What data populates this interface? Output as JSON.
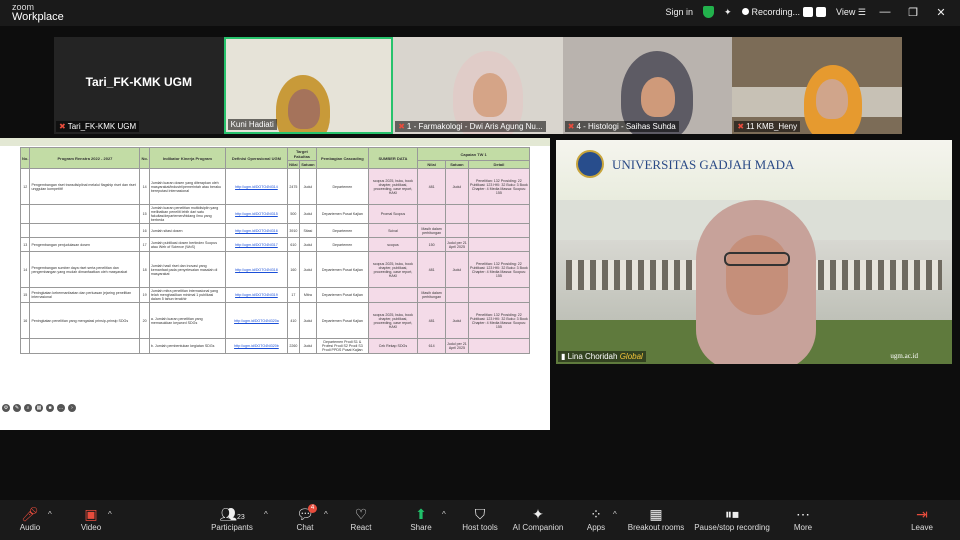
{
  "app": {
    "line1": "zoom",
    "line2": "Workplace"
  },
  "titlebar": {
    "sign_in": "Sign in",
    "recording": "Recording...",
    "view": "View"
  },
  "gallery": [
    {
      "name": "Tari_FK-KMK UGM",
      "big": "Tari_FK-KMK UGM"
    },
    {
      "name": "Kuni Hadiati"
    },
    {
      "name": "1 - Farmakologi - Dwi Aris Agung Nu..."
    },
    {
      "name": "4 - Histologi - Saihas Suhda"
    },
    {
      "name": "11 KMB_Heny"
    }
  ],
  "sheet": {
    "headers": [
      "No.",
      "Program Renstra 2022 - 2027",
      "No.",
      "Indikator Kinerja Program",
      "Definisi Operasional UGM",
      "Target Fakultas",
      "Pembagian Cascading",
      "SUMBER DATA",
      "Capaian TW 1"
    ],
    "subheaders": [
      "Nilai",
      "Satuan",
      "Nilai",
      "Satuan",
      "Detail"
    ],
    "rows": [
      {
        "no": "12",
        "program": "Pengembangan riset transdisiplinal melalui flagship riset dan riset unggulan kompetitif",
        "no2": "14",
        "indikator": "Jumlah luaran dosen yang diterapkan oleh masyarakat/industri/pemerintah atau beraku bereputasi internasional",
        "link": "http://ugm.id/DOTO4NI314",
        "nilai": "2475",
        "satuan": "Judul",
        "casc": "Departemen",
        "sumber": "scopus 2025, buku, book chapter, publikasi, proceeding, case report, HAKI",
        "c_nilai": "481",
        "c_sat": "Judul",
        "detail": "Penelitian: 132 Prosiding: 22 Publikasi: 123 HKI: 32 Buku: 3 Book Chapter: 4 Media Massa: Scopus: 155"
      },
      {
        "no": "",
        "program": "",
        "no2": "15",
        "indikator": "Jumlah luaran penelitian multidisiplin yang melibatkan peneliti lebih dari satu fakultas/departemen/bidang ilmu yang berbeda",
        "link": "http://ugm.id/DOTO4NI315",
        "nilai": "500",
        "satuan": "Judul",
        "casc": "Departemen Pusat Kajian",
        "sumber": "Promal Scopus",
        "c_nilai": "",
        "c_sat": "",
        "detail": ""
      },
      {
        "no": "",
        "program": "",
        "no2": "16",
        "indikator": "Jumlah sitasi dosen",
        "link": "http://ugm.id/DOTO4NI316",
        "nilai": "3910",
        "satuan": "Sitasi",
        "casc": "Departemen",
        "sumber": "Scival",
        "c_nilai": "Masih dalam perhitungan",
        "c_sat": "",
        "detail": ""
      },
      {
        "no": "13",
        "program": "Pengembangan penjudulasan dosen",
        "no2": "17",
        "indikator": "Jumlah publikasi dosen bertindex Scopus atau Web of Science (WoS)",
        "link": "http://ugm.id/DOTO4NI317",
        "nilai": "610",
        "satuan": "Judul",
        "casc": "Departemen",
        "sumber": "scopus",
        "c_nilai": "150",
        "c_sat": "Judul per 21 April 2025",
        "detail": ""
      },
      {
        "no": "14",
        "program": "Pengembangan sumber daya riset serta penelitian dan pengembangan yang mudah dimanfaatkan oleh masyarakat",
        "no2": "18",
        "indikator": "Jumlah hasil riset dan inovasi yang kemanfaat pada penyelesaian masalah di masyarakat",
        "link": "http://ugm.id/DOTO4NI318",
        "nilai": "160",
        "satuan": "Judul",
        "casc": "Departemen Pusat Kajian",
        "sumber": "scopus 2025, buku, book chapter, publikasi, proceeding, case report, HAKI",
        "c_nilai": "481",
        "c_sat": "Judul",
        "detail": "Penelitian: 132 Prosiding: 22 Publikasi: 123 HKI: 32 Buku: 3 Book Chapter: 4 Media Massa: Scopus: 155"
      },
      {
        "no": "15",
        "program": "Peningkatan kebermanfaatan dan perluasan jejaring penelitian internasional",
        "no2": "19",
        "indikator": "Jumlah mitra penelitian internasional yang telah menghasilkan minimal 1 publikasi dalam 5 tahun terakhir",
        "link": "http://ugm.id/DOTO4NI319",
        "nilai": "17",
        "satuan": "Mitra",
        "casc": "Departemen Pusat Kajian",
        "sumber": "",
        "c_nilai": "Masih dalam perhitungan",
        "c_sat": "",
        "detail": ""
      },
      {
        "no": "16",
        "program": "Peningkatan penelitian yang mengatasi prinsip-prinsip SDGs",
        "no2": "20",
        "indikator": "a. Jumlah luaran penelitian yang memasukkan keyword SDGs",
        "link": "http://ugm.id/DOTO4NI320a",
        "nilai": "410",
        "satuan": "Judul",
        "casc": "Departemen Pusat Kajian",
        "sumber": "scopus 2025, buku, book chapter, publikasi, proceeding, case report, HAKI",
        "c_nilai": "481",
        "c_sat": "Judul",
        "detail": "Penelitian: 132 Prosiding: 22 Publikasi: 123 HKI: 32 Buku: 3 Book Chapter: 4 Media Massa: Scopus: 155"
      },
      {
        "no": "",
        "program": "",
        "no2": "",
        "indikator": "b. Jumlah pembentukan kegiatan SDGs",
        "link": "http://ugm.id/DOTO4NI320b",
        "nilai": "2260",
        "satuan": "Judul",
        "casc": "Departemen Prodi S1 & Profesi Prodi S2 Prodi S3 Prodi PPDS Pusat Kajian",
        "sumber": "Cek Rekap SDGs",
        "c_nilai": "614",
        "c_sat": "Judul per 21 April 2025",
        "detail": ""
      }
    ]
  },
  "video_main": {
    "banner": "UNIVERSITAS GADJAH MADA",
    "name": "Lina Choridah",
    "tag": "Global",
    "site": "ugm.ac.id"
  },
  "toolbar": {
    "audio": "Audio",
    "video": "Video",
    "participants": "Participants",
    "participants_count": "23",
    "chat": "Chat",
    "chat_badge": "4",
    "react": "React",
    "share": "Share",
    "host_tools": "Host tools",
    "ai": "AI Companion",
    "apps": "Apps",
    "breakout": "Breakout rooms",
    "pause_rec": "Pause/stop recording",
    "more": "More",
    "leave": "Leave"
  },
  "colors": {
    "active_border": "#27c26c",
    "muted_red": "#e74c3c",
    "share_green": "#20c06a",
    "header_green": "#c2dca5",
    "detail_pink": "#f4dbe8"
  }
}
